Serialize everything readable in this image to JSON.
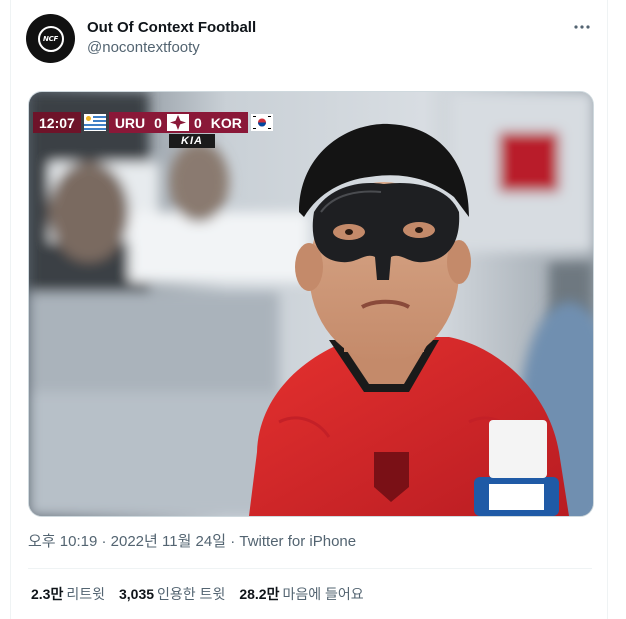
{
  "author": {
    "display_name": "Out Of Context Football",
    "handle": "@nocontextfooty",
    "avatar_text": "NCF"
  },
  "media": {
    "scorebug": {
      "time": "12:07",
      "home_team": "URU",
      "home_score": "0",
      "away_score": "0",
      "away_team": "KOR"
    },
    "sponsor": "KIA"
  },
  "meta": {
    "time": "오후 10:19",
    "separator": "·",
    "date": "2022년 11월 24일",
    "source": "Twitter for iPhone"
  },
  "stats": {
    "retweets_value": "2.3만",
    "retweets_label": "리트윗",
    "quotes_value": "3,035",
    "quotes_label": "인용한 트윗",
    "likes_value": "28.2만",
    "likes_label": "마음에 들어요"
  },
  "icons": {
    "more": "more-horizontal-icon"
  },
  "colors": {
    "text_primary": "#0f1419",
    "text_secondary": "#536471",
    "border": "#eff3f4",
    "scorebug_maroon": "#8a1838",
    "jersey_red": "#d9262c"
  }
}
